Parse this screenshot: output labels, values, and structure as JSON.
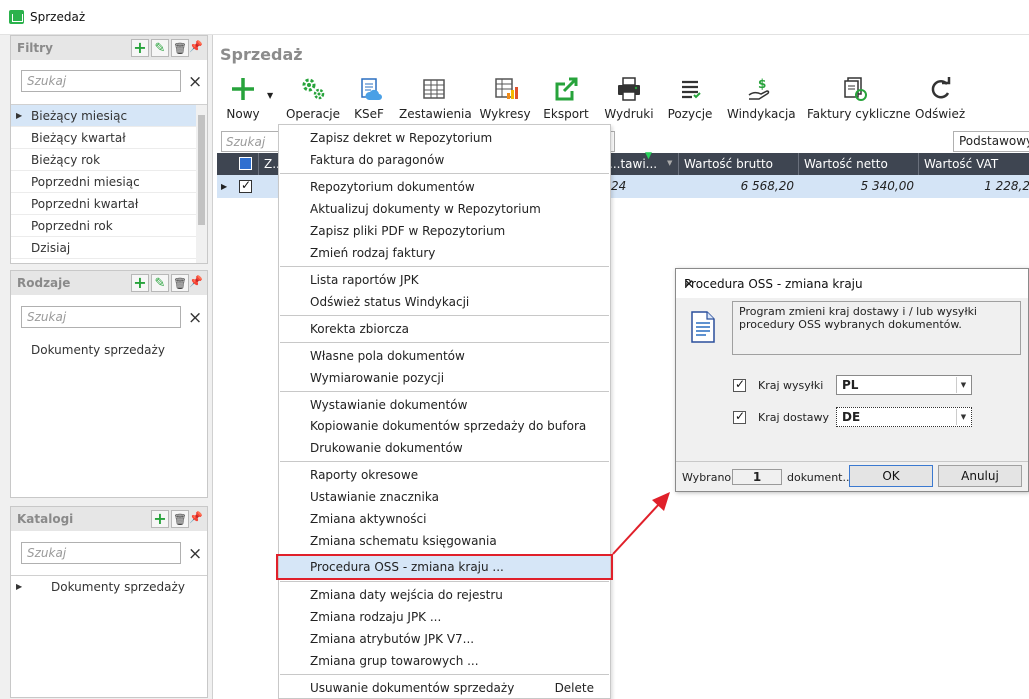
{
  "window": {
    "title": "Sprzedaż"
  },
  "filters": {
    "title": "Filtry",
    "search_placeholder": "Szukaj",
    "items": [
      "Bieżący miesiąc",
      "Bieżący kwartał",
      "Bieżący rok",
      "Poprzedni miesiąc",
      "Poprzedni kwartał",
      "Poprzedni rok",
      "Dzisiaj"
    ],
    "selected": "Bieżący miesiąc"
  },
  "kinds": {
    "title": "Rodzaje",
    "search_placeholder": "Szukaj",
    "items": [
      "Dokumenty sprzedaży"
    ]
  },
  "catalogs": {
    "title": "Katalogi",
    "search_placeholder": "Szukaj",
    "items": [
      "Dokumenty sprzedaży"
    ]
  },
  "main": {
    "title": "Sprzedaż",
    "toolbar": [
      "Nowy",
      "Operacje",
      "KSeF",
      "Zestawienia",
      "Wykresy",
      "Eksport",
      "Wydruki",
      "Pozycje",
      "Windykacja",
      "Faktury cykliczne",
      "Odśwież"
    ],
    "grid_search_placeholder": "Szukaj",
    "view_select": "Podstawowy u",
    "columns": [
      "Z...",
      "...tawi...",
      "Wartość brutto",
      "Wartość netto",
      "Wartość VAT"
    ],
    "row": {
      "partial": "24",
      "brutto": "6 568,20",
      "netto": "5 340,00",
      "vat": "1 228,2"
    }
  },
  "menu": {
    "groups": [
      [
        "Zapisz dekret w Repozytorium",
        "Faktura do paragonów"
      ],
      [
        "Repozytorium dokumentów",
        "Aktualizuj dokumenty w Repozytorium",
        "Zapisz pliki PDF w Repozytorium",
        "Zmień rodzaj faktury"
      ],
      [
        "Lista raportów JPK",
        "Odśwież status Windykacji"
      ],
      [
        "Korekta zbiorcza"
      ],
      [
        "Własne pola dokumentów",
        "Wymiarowanie pozycji"
      ],
      [
        "Wystawianie dokumentów",
        "Kopiowanie dokumentów sprzedaży do bufora",
        "Drukowanie dokumentów"
      ],
      [
        "Raporty okresowe",
        "Ustawianie znacznika",
        "Zmiana aktywności",
        "Zmiana schematu księgowania"
      ],
      [
        "Procedura OSS - zmiana kraju ..."
      ],
      [
        "Zmiana daty wejścia do rejestru",
        "Zmiana rodzaju JPK ...",
        "Zmiana atrybutów JPK V7...",
        "Zmiana grup towarowych ..."
      ],
      [
        "Usuwanie dokumentów sprzedaży"
      ]
    ],
    "delete_shortcut": "Delete",
    "highlighted": "Procedura OSS - zmiana kraju ..."
  },
  "dialog": {
    "title": "Procedura OSS - zmiana kraju",
    "info": "Program zmieni kraj dostawy i / lub wysyłki procedury OSS wybranych dokumentów.",
    "ship_label": "Kraj wysyłki",
    "ship_value": "PL",
    "delivery_label": "Kraj dostawy",
    "delivery_value": "DE",
    "selected_label": "Wybrano",
    "selected_count": "1",
    "selected_suffix": "dokument...",
    "ok": "OK",
    "cancel": "Anuluj"
  },
  "colors": {
    "accent_green": "#27a33b",
    "header_dark": "#3e4551",
    "selection": "#d6e6f7",
    "highlight_red": "#e0202a"
  }
}
